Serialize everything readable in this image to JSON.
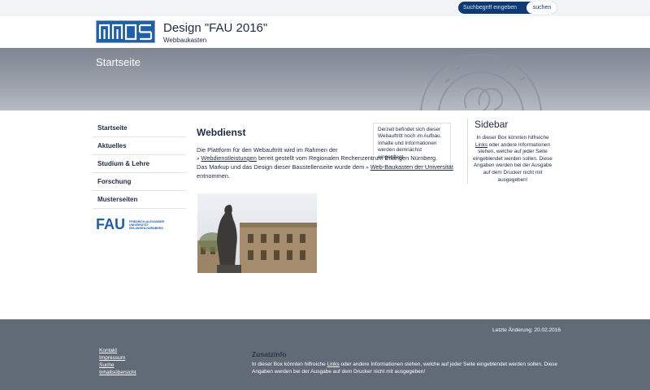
{
  "search": {
    "placeholder": "Suchbegriff eingeben",
    "button_label": "suchen"
  },
  "header": {
    "title": "Design \"FAU 2016\"",
    "subtitle": "Webbaukasten"
  },
  "hero": {
    "page_title": "Startseite"
  },
  "nav": {
    "items": [
      {
        "label": "Startseite"
      },
      {
        "label": "Aktuelles"
      },
      {
        "label": "Studium & Lehre"
      },
      {
        "label": "Forschung"
      },
      {
        "label": "Musterseiten"
      }
    ]
  },
  "fau_logo": {
    "mark": "FAU",
    "line1": "FRIEDRICH-ALEXANDER",
    "line2": "UNIVERSITÄT",
    "line3": "ERLANGEN-NÜRNBERG"
  },
  "main": {
    "title": "Webdienst",
    "p1_pre": "Die Plattform für den Webauftritt wird im Rahmen der",
    "link1": "Webdienstleistungen",
    "p1_post": " bereit gestellt vom Regionalen Rechenzentrum Erlangen Nürnberg.",
    "p2_pre": "Das Markup und das Design dieser Baustellenseite wurde dem ",
    "link2": "Web-Baukasten der Universität",
    "p2_post": "entnommen.",
    "notice": "Derzeit befindet sich dieser Webauftritt noch im Aufbau. Inhalte und Informationen werden demnächst eingepflegt."
  },
  "sidebar": {
    "title": "Sidebar",
    "text_pre": "In dieser Box könnten hilfreiche ",
    "link": "Links",
    "text_post": " oder andere Informationen stehen, welche auf jeder Seite eingeblendet werden sollen. Diese Angaben werden bei der Ausgabe auf dem Drucker nicht mit ausgegeben!"
  },
  "footer": {
    "last_change": "Letzte Änderung: 20.02.2016",
    "links": [
      "Kontakt",
      "Impressum",
      "Suche",
      "Inhaltsübersicht"
    ],
    "extra_title": "Zusatzinfo",
    "extra_pre": "In dieser Box könnten hilfreiche ",
    "extra_link": "Links",
    "extra_post": " oder  andere Informationen stehen, welche auf jeder Seite eingeblendet werden sollen. Diese Angaben werden bei der Ausgabe auf dem Drucker nicht mit ausgegeben!"
  },
  "colors": {
    "brand_blue": "#0e3a73",
    "logo_blue": "#1e5fa8",
    "footer": "#616b78",
    "hero": "#8f959f"
  }
}
